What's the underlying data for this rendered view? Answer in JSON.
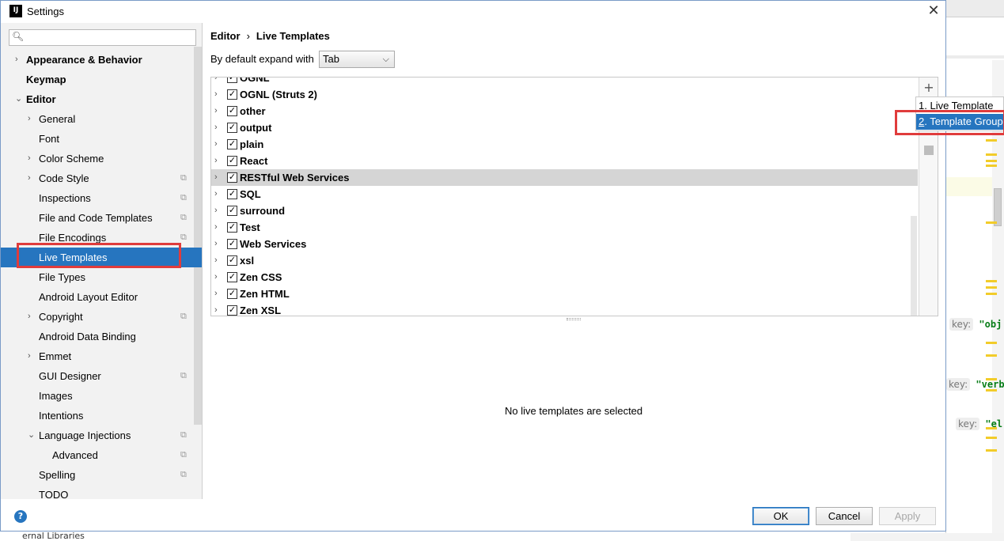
{
  "window": {
    "title": "Settings",
    "app_icon": "IJ"
  },
  "search": {
    "placeholder": ""
  },
  "sidebar": {
    "items": [
      {
        "label": "Appearance & Behavior",
        "level": 0,
        "expandable": true,
        "expanded": false,
        "bold": true,
        "copy": false
      },
      {
        "label": "Keymap",
        "level": 0,
        "expandable": false,
        "bold": true,
        "copy": false
      },
      {
        "label": "Editor",
        "level": 0,
        "expandable": true,
        "expanded": true,
        "bold": true,
        "copy": false
      },
      {
        "label": "General",
        "level": 1,
        "expandable": true,
        "expanded": false,
        "copy": false
      },
      {
        "label": "Font",
        "level": 1,
        "expandable": false,
        "copy": false
      },
      {
        "label": "Color Scheme",
        "level": 1,
        "expandable": true,
        "expanded": false,
        "copy": false
      },
      {
        "label": "Code Style",
        "level": 1,
        "expandable": true,
        "expanded": false,
        "copy": true
      },
      {
        "label": "Inspections",
        "level": 1,
        "expandable": false,
        "copy": true
      },
      {
        "label": "File and Code Templates",
        "level": 1,
        "expandable": false,
        "copy": true
      },
      {
        "label": "File Encodings",
        "level": 1,
        "expandable": false,
        "copy": true
      },
      {
        "label": "Live Templates",
        "level": 1,
        "expandable": false,
        "copy": false,
        "selected": true
      },
      {
        "label": "File Types",
        "level": 1,
        "expandable": false,
        "copy": false
      },
      {
        "label": "Android Layout Editor",
        "level": 1,
        "expandable": false,
        "copy": false
      },
      {
        "label": "Copyright",
        "level": 1,
        "expandable": true,
        "expanded": false,
        "copy": true
      },
      {
        "label": "Android Data Binding",
        "level": 1,
        "expandable": false,
        "copy": false
      },
      {
        "label": "Emmet",
        "level": 1,
        "expandable": true,
        "expanded": false,
        "copy": false
      },
      {
        "label": "GUI Designer",
        "level": 1,
        "expandable": false,
        "copy": true
      },
      {
        "label": "Images",
        "level": 1,
        "expandable": false,
        "copy": false
      },
      {
        "label": "Intentions",
        "level": 1,
        "expandable": false,
        "copy": false
      },
      {
        "label": "Language Injections",
        "level": 1,
        "expandable": true,
        "expanded": true,
        "copy": true
      },
      {
        "label": "Advanced",
        "level": 2,
        "expandable": false,
        "copy": true
      },
      {
        "label": "Spelling",
        "level": 1,
        "expandable": false,
        "copy": true
      },
      {
        "label": "TODO",
        "level": 1,
        "expandable": false,
        "copy": false
      }
    ]
  },
  "breadcrumb": {
    "parent": "Editor",
    "separator": "›",
    "current": "Live Templates"
  },
  "expand": {
    "label": "By default expand with",
    "value": "Tab"
  },
  "templates": {
    "groups": [
      {
        "name": "OGNL",
        "checked": true
      },
      {
        "name": "OGNL (Struts 2)",
        "checked": true
      },
      {
        "name": "other",
        "checked": true
      },
      {
        "name": "output",
        "checked": true
      },
      {
        "name": "plain",
        "checked": true
      },
      {
        "name": "React",
        "checked": true
      },
      {
        "name": "RESTful Web Services",
        "checked": true,
        "highlighted": true
      },
      {
        "name": "SQL",
        "checked": true
      },
      {
        "name": "surround",
        "checked": true
      },
      {
        "name": "Test",
        "checked": true
      },
      {
        "name": "Web Services",
        "checked": true
      },
      {
        "name": "xsl",
        "checked": true
      },
      {
        "name": "Zen CSS",
        "checked": true
      },
      {
        "name": "Zen HTML",
        "checked": true
      },
      {
        "name": "Zen XSL",
        "checked": true
      }
    ],
    "empty_message": "No live templates are selected"
  },
  "popup_menu": {
    "items": [
      {
        "mnemonic": "1",
        "label": ". Live Template"
      },
      {
        "mnemonic": "2",
        "label": ". Template Group",
        "active": true
      }
    ]
  },
  "buttons": {
    "ok": "OK",
    "cancel": "Cancel",
    "apply": "Apply",
    "help": "?"
  },
  "background": {
    "code_lines": [
      {
        "key": "key:",
        "value": "\"obj"
      },
      {
        "key": "key:",
        "value": "\"verb"
      },
      {
        "key": "key:",
        "value": "\"el"
      }
    ],
    "bottom_text": "ernal Libraries"
  },
  "colors": {
    "selection": "#2675bf",
    "highlight_box": "#e03c3c",
    "row_highlight": "#d5d5d5"
  }
}
